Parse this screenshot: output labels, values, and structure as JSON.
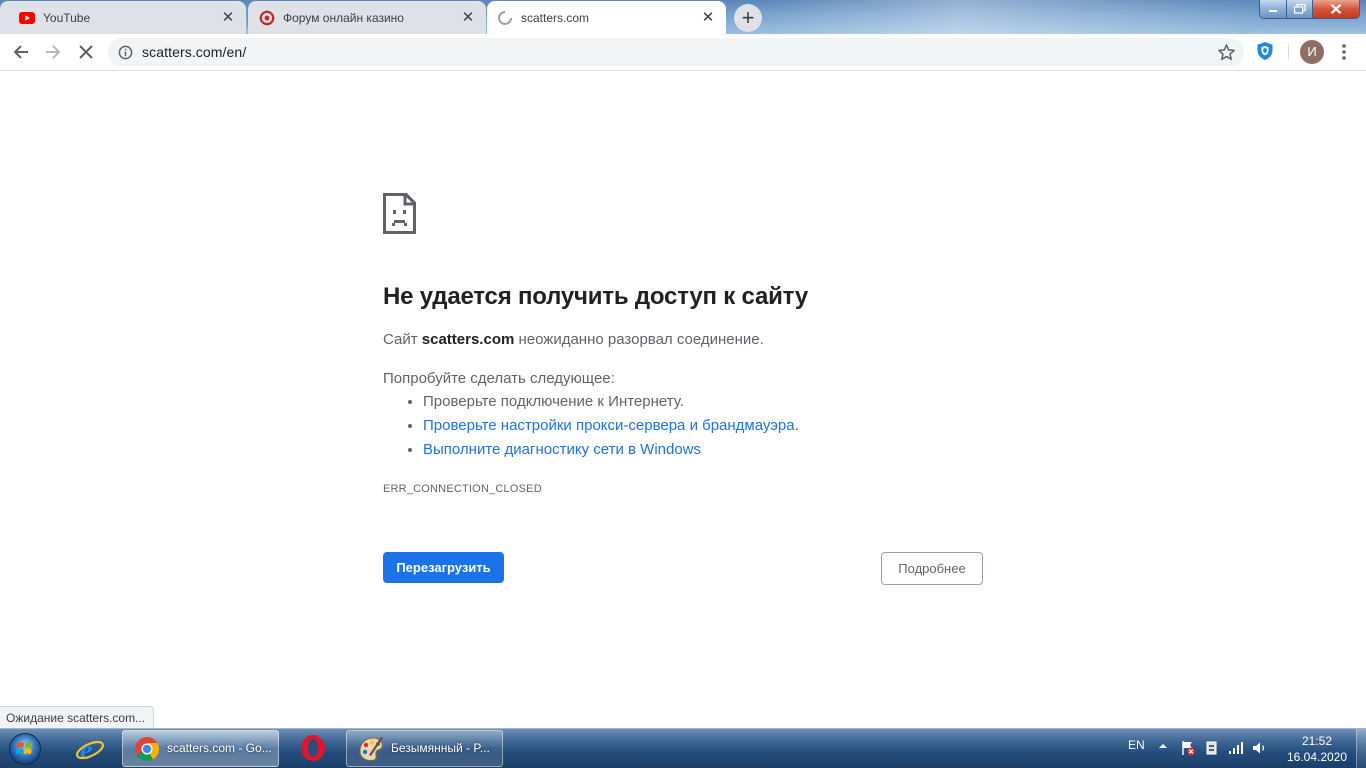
{
  "tabs": [
    {
      "title": "YouTube",
      "icon": "youtube-icon",
      "active": false
    },
    {
      "title": "Форум онлайн казино",
      "icon": "casino-forum-icon",
      "active": false
    },
    {
      "title": "scatters.com",
      "icon": "loading-spinner-icon",
      "active": true
    }
  ],
  "toolbar": {
    "url": "scatters.com/en/",
    "profile_initial": "И"
  },
  "error": {
    "heading": "Не удается получить доступ к сайту",
    "summary_prefix": "Сайт",
    "summary_host": "scatters.com",
    "summary_suffix": "неожиданно разорвал соединение.",
    "try_label": "Попробуйте сделать следующее:",
    "suggestions": {
      "check_connection": "Проверьте подключение к Интернету.",
      "check_proxy": "Проверьте настройки прокси-сервера и брандмауэра",
      "run_diagnostics": "Выполните диагностику сети в Windows"
    },
    "code": "ERR_CONNECTION_CLOSED",
    "reload_label": "Перезагрузить",
    "details_label": "Подробнее"
  },
  "status_text": "Ожидание scatters.com...",
  "taskbar": {
    "items": [
      {
        "label": "scatters.com - Go...",
        "app": "chrome-icon"
      },
      {
        "label": "",
        "app": "opera-icon"
      },
      {
        "label": "Безымянный - P...",
        "app": "paint-icon"
      }
    ],
    "language": "EN",
    "time": "21:52",
    "date": "16.04.2020"
  },
  "colors": {
    "accent_blue": "#1a73e8",
    "youtube_red": "#ff0000",
    "tab_inactive": "#dee1e6"
  }
}
